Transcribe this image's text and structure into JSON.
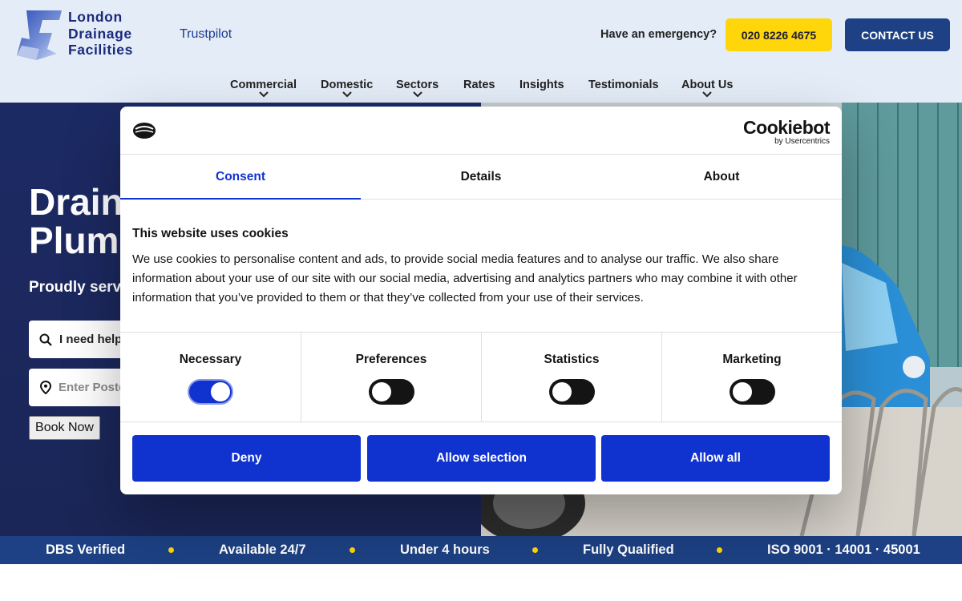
{
  "header": {
    "logo_lines": [
      "London",
      "Drainage",
      "Facilities"
    ],
    "trustpilot": "Trustpilot",
    "emergency_text": "Have an emergency?",
    "phone": "020 8226 4675",
    "contact": "CONTACT US"
  },
  "nav": {
    "items": [
      {
        "label": "Commercial",
        "dropdown": true
      },
      {
        "label": "Domestic",
        "dropdown": true
      },
      {
        "label": "Sectors",
        "dropdown": true
      },
      {
        "label": "Rates",
        "dropdown": false
      },
      {
        "label": "Insights",
        "dropdown": false
      },
      {
        "label": "Testimonials",
        "dropdown": false
      },
      {
        "label": "About Us",
        "dropdown": true
      }
    ]
  },
  "hero": {
    "title_line1": "Drain",
    "title_line2": "Plumb",
    "subtitle": "Proudly servi",
    "search_text": "I need help",
    "postcode_placeholder": "Enter Postc",
    "book_label": "Book Now"
  },
  "trust_bar": {
    "items": [
      "DBS Verified",
      "Available 24/7",
      "Under 4 hours",
      "Fully Qualified",
      "ISO 9001 · 14001 · 45001"
    ]
  },
  "cookie_modal": {
    "brand": "Cookiebot",
    "brand_sub": "by Usercentrics",
    "tabs": [
      {
        "label": "Consent",
        "active": true
      },
      {
        "label": "Details",
        "active": false
      },
      {
        "label": "About",
        "active": false
      }
    ],
    "title": "This website uses cookies",
    "body": "We use cookies to personalise content and ads, to provide social media features and to analyse our traffic. We also share information about your use of our site with our social media, advertising and analytics partners who may combine it with other information that you’ve provided to them or that they’ve collected from your use of their services.",
    "toggles": [
      {
        "label": "Necessary",
        "on": true
      },
      {
        "label": "Preferences",
        "on": false
      },
      {
        "label": "Statistics",
        "on": false
      },
      {
        "label": "Marketing",
        "on": false
      }
    ],
    "buttons": {
      "deny": "Deny",
      "allow_selection": "Allow selection",
      "allow_all": "Allow all"
    }
  },
  "colors": {
    "accent_blue": "#1032cf",
    "navy": "#1d4184",
    "yellow": "#ffd60a",
    "header_bg": "#e4ecf7"
  }
}
